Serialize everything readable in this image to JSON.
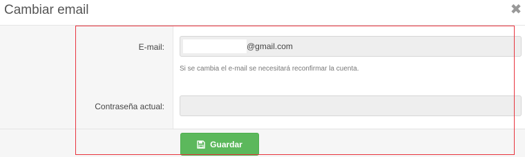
{
  "dialog": {
    "title": "Cambiar email",
    "close_icon": "close-icon"
  },
  "form": {
    "email_label": "E-mail:",
    "email_value": "@gmail.com",
    "email_help": "Si se cambia el e-mail se necesitará reconfirmar la cuenta.",
    "password_label": "Contraseña actual:",
    "password_value": ""
  },
  "actions": {
    "save_label": "Guardar",
    "save_icon": "floppy-disk-icon"
  },
  "colors": {
    "save_button": "#5cb85c",
    "highlight_border": "#e8323c"
  }
}
